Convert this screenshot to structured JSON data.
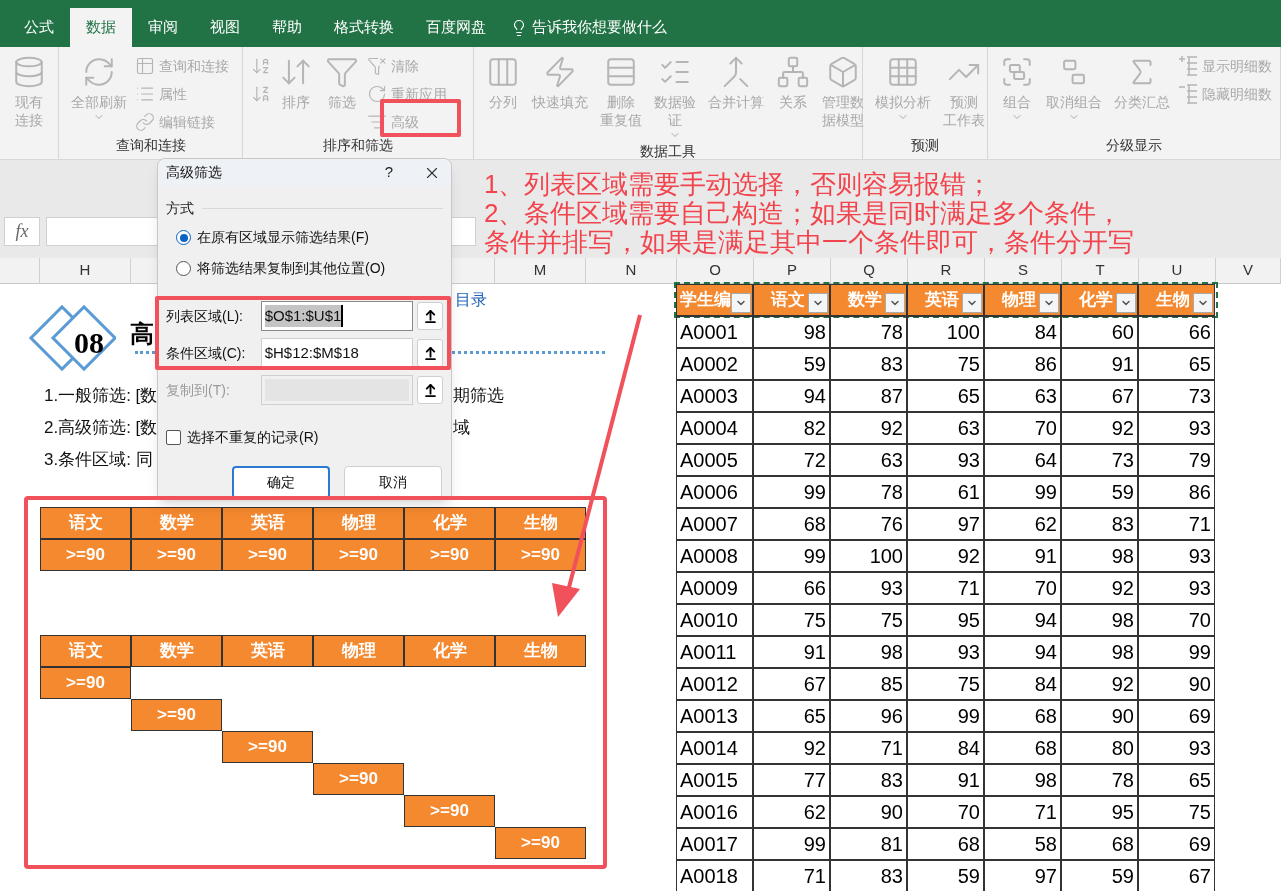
{
  "tabs": [
    {
      "label": "公式",
      "selected": false
    },
    {
      "label": "数据",
      "selected": true
    },
    {
      "label": "审阅",
      "selected": false
    },
    {
      "label": "视图",
      "selected": false
    },
    {
      "label": "帮助",
      "selected": false
    },
    {
      "label": "格式转换",
      "selected": false
    },
    {
      "label": "百度网盘",
      "selected": false
    }
  ],
  "tell_me": "告诉我你想要做什么",
  "ribbon": {
    "groups": [
      {
        "items": [
          {
            "kind": "large",
            "lines": [
              "现有",
              "连接"
            ],
            "dropdown": false,
            "disabled": true
          }
        ]
      },
      {
        "label": "查询和连接",
        "items": [
          {
            "kind": "large",
            "label": "全部刷新",
            "dropdown": true,
            "disabled": true
          },
          {
            "kind": "stack",
            "items": [
              {
                "label": "查询和连接",
                "disabled": true
              },
              {
                "label": "属性",
                "disabled": true
              },
              {
                "label": "编辑链接",
                "disabled": true
              }
            ]
          }
        ]
      },
      {
        "label": "排序和筛选",
        "items": [
          {
            "kind": "stack",
            "items": [
              {
                "disabled": true
              },
              {
                "disabled": true
              }
            ]
          },
          {
            "kind": "large",
            "label": "排序",
            "dropdown": false,
            "disabled": true
          },
          {
            "kind": "large",
            "label": "筛选",
            "dropdown": false,
            "disabled": true
          },
          {
            "kind": "stack",
            "items": [
              {
                "label": "清除",
                "disabled": true
              },
              {
                "label": "重新应用",
                "disabled": true
              },
              {
                "label": "高级",
                "disabled": true
              }
            ]
          }
        ]
      },
      {
        "label": "数据工具",
        "items": [
          {
            "kind": "large",
            "label": "分列",
            "dropdown": false,
            "disabled": true
          },
          {
            "kind": "large",
            "label": "快速填充",
            "dropdown": false,
            "disabled": true
          },
          {
            "kind": "large",
            "lines": [
              "删除",
              "重复值"
            ],
            "dropdown": false,
            "disabled": true
          },
          {
            "kind": "large",
            "lines": [
              "数据验",
              "证"
            ],
            "dropdown": true,
            "disabled": true
          },
          {
            "kind": "large",
            "label": "合并计算",
            "dropdown": false,
            "disabled": true
          },
          {
            "kind": "large",
            "label": "关系",
            "dropdown": false,
            "disabled": true
          },
          {
            "kind": "large",
            "lines": [
              "管理数",
              "据模型"
            ],
            "dropdown": false,
            "disabled": true
          }
        ]
      },
      {
        "label": "预测",
        "items": [
          {
            "kind": "large",
            "label": "模拟分析",
            "dropdown": true,
            "disabled": true
          },
          {
            "kind": "large",
            "lines": [
              "预测",
              "工作表"
            ],
            "dropdown": false,
            "disabled": true
          }
        ]
      },
      {
        "label": "分级显示",
        "items": [
          {
            "kind": "large",
            "label": "组合",
            "dropdown": true,
            "disabled": true
          },
          {
            "kind": "large",
            "label": "取消组合",
            "dropdown": true,
            "disabled": true
          },
          {
            "kind": "large",
            "label": "分类汇总",
            "dropdown": false,
            "disabled": true
          },
          {
            "kind": "stack",
            "items": [
              {
                "label": "显示明细数",
                "disabled": true
              },
              {
                "label": "隐藏明细数",
                "disabled": true
              }
            ]
          }
        ]
      }
    ]
  },
  "formula_bar": {
    "fx": "fx"
  },
  "column_headers": [
    "H",
    "M",
    "N",
    "O",
    "P",
    "Q",
    "R",
    "S",
    "T",
    "U",
    "V"
  ],
  "section": {
    "number": "08",
    "title": "高",
    "link": "目录",
    "notes": [
      {
        "left": "1.一般筛选: [数",
        "right": "期筛选"
      },
      {
        "left": "2.高级筛选: [数",
        "right": "域"
      },
      {
        "left": "3.条件区域: 同"
      }
    ]
  },
  "criteria_tables": [
    {
      "headers": [
        "语文",
        "数学",
        "英语",
        "物理",
        "化学",
        "生物"
      ],
      "rows": [
        [
          ">=90",
          ">=90",
          ">=90",
          ">=90",
          ">=90",
          ">=90"
        ]
      ]
    },
    {
      "headers": [
        "语文",
        "数学",
        "英语",
        "物理",
        "化学",
        "生物"
      ],
      "rows": [
        [
          ">=90",
          null,
          null,
          null,
          null,
          null
        ],
        [
          null,
          ">=90",
          null,
          null,
          null,
          null
        ],
        [
          null,
          null,
          ">=90",
          null,
          null,
          null
        ],
        [
          null,
          null,
          null,
          ">=90",
          null,
          null
        ],
        [
          null,
          null,
          null,
          null,
          ">=90",
          null
        ],
        [
          null,
          null,
          null,
          null,
          null,
          ">=90"
        ]
      ]
    }
  ],
  "score_table": {
    "headers": [
      "学生编",
      "语文",
      "数学",
      "英语",
      "物理",
      "化学",
      "生物"
    ],
    "rows": [
      [
        "A0001",
        "98",
        "78",
        "100",
        "84",
        "60",
        "66"
      ],
      [
        "A0002",
        "59",
        "83",
        "75",
        "86",
        "91",
        "65"
      ],
      [
        "A0003",
        "94",
        "87",
        "65",
        "63",
        "67",
        "73"
      ],
      [
        "A0004",
        "82",
        "92",
        "63",
        "70",
        "92",
        "93"
      ],
      [
        "A0005",
        "72",
        "63",
        "93",
        "64",
        "73",
        "79"
      ],
      [
        "A0006",
        "99",
        "78",
        "61",
        "99",
        "59",
        "86"
      ],
      [
        "A0007",
        "68",
        "76",
        "97",
        "62",
        "83",
        "71"
      ],
      [
        "A0008",
        "99",
        "100",
        "92",
        "91",
        "98",
        "93"
      ],
      [
        "A0009",
        "66",
        "93",
        "71",
        "70",
        "92",
        "93"
      ],
      [
        "A0010",
        "75",
        "75",
        "95",
        "94",
        "98",
        "70"
      ],
      [
        "A0011",
        "91",
        "98",
        "93",
        "94",
        "98",
        "99"
      ],
      [
        "A0012",
        "67",
        "85",
        "75",
        "84",
        "92",
        "90"
      ],
      [
        "A0013",
        "65",
        "96",
        "99",
        "68",
        "90",
        "69"
      ],
      [
        "A0014",
        "92",
        "71",
        "84",
        "68",
        "80",
        "93"
      ],
      [
        "A0015",
        "77",
        "83",
        "91",
        "98",
        "78",
        "65"
      ],
      [
        "A0016",
        "62",
        "90",
        "70",
        "71",
        "95",
        "75"
      ],
      [
        "A0017",
        "99",
        "81",
        "68",
        "58",
        "68",
        "69"
      ],
      [
        "A0018",
        "71",
        "83",
        "59",
        "97",
        "59",
        "67"
      ]
    ]
  },
  "dialog": {
    "title": "高级筛选",
    "help": "?",
    "section": "方式",
    "options": [
      {
        "label": "在原有区域显示筛选结果(F)",
        "selected": true
      },
      {
        "label": "将筛选结果复制到其他位置(O)",
        "selected": false
      }
    ],
    "fields": [
      {
        "label": "列表区域(L):",
        "value": "$O$1:$U$1",
        "selected": true,
        "disabled": false
      },
      {
        "label": "条件区域(C):",
        "value": "$H$12:$M$18",
        "selected": false,
        "disabled": false
      },
      {
        "label": "复制到(T):",
        "selected": false,
        "disabled": true
      }
    ],
    "checkbox": {
      "label": "选择不重复的记录(R)",
      "checked": false
    },
    "buttons": [
      {
        "label": "确定",
        "default": true
      },
      {
        "label": "取消",
        "default": false
      }
    ]
  },
  "annotation": [
    "1、列表区域需要手动选择，否则容易报错；",
    "2、条件区域需要自己构造；如果是同时满足多个条件，",
    "条件并排写，如果是满足其中一个条件即可，条件分开写"
  ]
}
